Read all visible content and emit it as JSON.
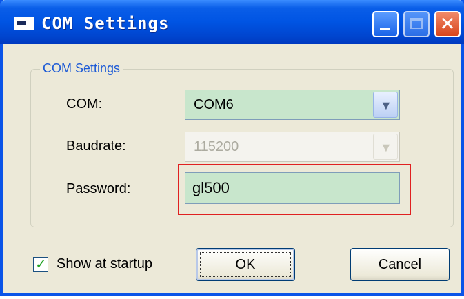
{
  "window": {
    "title": "COM Settings",
    "icon": "app-window-icon",
    "controls": {
      "minimize": "minimize-icon",
      "maximize": "maximize-icon",
      "close": "✕"
    }
  },
  "group": {
    "legend": "COM Settings",
    "com": {
      "label": "COM:",
      "value": "COM6",
      "enabled": true
    },
    "baudrate": {
      "label": "Baudrate:",
      "value": "115200",
      "enabled": false
    },
    "password": {
      "label": "Password:",
      "value": "gl500"
    }
  },
  "footer": {
    "show_at_startup": {
      "label": "Show at startup",
      "checked": true
    },
    "ok_label": "OK",
    "cancel_label": "Cancel"
  },
  "colors": {
    "titlebar": "#0054e3",
    "legend_text": "#1c5ad6",
    "field_bg": "#c8e6cc",
    "highlight": "#e02020",
    "frame_bg": "#ece9d8"
  }
}
